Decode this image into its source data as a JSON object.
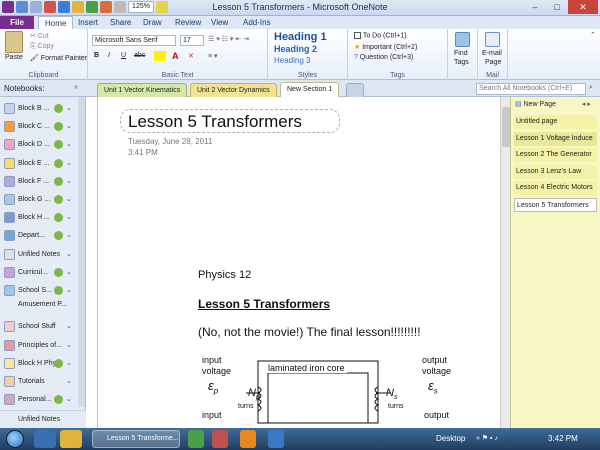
{
  "window": {
    "title": "Lesson 5 Transformers - Microsoft OneNote",
    "min": "–",
    "max": "□",
    "close": "✕"
  },
  "ribbon_tabs": {
    "file": "File",
    "tabs": [
      "Home",
      "Insert",
      "Share",
      "Draw",
      "Review",
      "View",
      "Add-Ins"
    ]
  },
  "qat": {
    "zoom": "125%"
  },
  "clipboard": {
    "paste": "Paste",
    "cut": "Cut",
    "copy": "Copy",
    "format_painter": "Format Painter",
    "label": "Clipboard"
  },
  "basic_text": {
    "font": "Microsoft Sans Serif",
    "size": "17",
    "label": "Basic Text",
    "bold": "B",
    "italic": "I",
    "underline": "U",
    "strike": "abc"
  },
  "styles": {
    "h1": "Heading 1",
    "h2": "Heading 2",
    "h3": "Heading 3",
    "label": "Styles"
  },
  "tags": {
    "todo": "To Do (Ctrl+1)",
    "important": "Important (Ctrl+2)",
    "question": "Question (Ctrl+3)",
    "label": "Tags"
  },
  "find_tags": {
    "label": "Find Tags",
    "l1": "Find",
    "l2": "Tags"
  },
  "email": {
    "l1": "E-mail",
    "l2": "Page",
    "label": "Mail"
  },
  "nav": {
    "notebooks_label": "Notebooks:",
    "sections": [
      "Unit 1 Vector Kinematics",
      "Unit 2 Vector Dynamics",
      "New Section 1"
    ],
    "search_placeholder": "Search All Notebooks (Ctrl+E)"
  },
  "notebooks": [
    {
      "label": "Block B ...",
      "color": "#c4d3ea"
    },
    {
      "label": "Block C ...",
      "color": "#ff9933"
    },
    {
      "label": "Block D ...",
      "color": "#f2a3c6"
    },
    {
      "label": "Block E ...",
      "color": "#ffd966"
    },
    {
      "label": "Block F ...",
      "color": "#b9a6e0"
    },
    {
      "label": "Block G ...",
      "color": "#a8c5e4"
    },
    {
      "label": "Block H ...",
      "color": "#7b9bd1"
    },
    {
      "label": "Depart...",
      "color": "#6fa8dc"
    },
    {
      "label": "Unfiled Notes",
      "color": "#e0e0e0"
    },
    {
      "label": "Curricul...",
      "color": "#c9a0dc"
    },
    {
      "label": "School S...",
      "color": "#9ec6e8"
    },
    {
      "label": "Amusement P...",
      "color": "#a8d08d"
    },
    {
      "label": "School Stuff",
      "color": "#f4cccc"
    },
    {
      "label": "Principles of...",
      "color": "#ea9999"
    },
    {
      "label": "Block H Phy...",
      "color": "#ffe599"
    },
    {
      "label": "Tutorials",
      "color": "#f9cb9c"
    },
    {
      "label": "Personal...",
      "color": "#d5a6bd"
    },
    {
      "label": "Block B",
      "color": "#a4c2f4"
    }
  ],
  "unfiled_bottom": "Unfiled Notes",
  "page": {
    "title": "Lesson 5 Transformers",
    "date": "Tuesday, June 28, 2011",
    "time": "3:41 PM",
    "line1": "Physics 12",
    "line2": "Lesson 5 Transformers",
    "line3": "(No, not the movie!)  The final lesson!!!!!!!!!",
    "input_voltage_1": "input",
    "input_voltage_2": "voltage",
    "eps_p": "ε",
    "eps_p_sub": "p",
    "core_label": "laminated iron core",
    "np": "N",
    "np_sub": "p",
    "np_turns": "turns",
    "ns": "N",
    "ns_sub": "s",
    "ns_turns": "turns",
    "output_voltage_1": "output",
    "output_voltage_2": "voltage",
    "eps_s": "ε",
    "eps_s_sub": "s",
    "input_bottom": "input",
    "output_bottom": "output"
  },
  "pagelist": {
    "new_page": "New Page",
    "items": [
      {
        "label": "Untitled page",
        "bg": "#f3f2a6"
      },
      {
        "label": "Lesson 1 Voltage Induce",
        "bg": "#e8e79a"
      },
      {
        "label": "Lesson 2 The Generator",
        "bg": "#f3f2a6"
      },
      {
        "label": "Lesson 3 Lenz's Law",
        "bg": "#f3f2a6"
      },
      {
        "label": "Lesson 4 Electric Motors",
        "bg": "#f3f2a6"
      },
      {
        "label": "Lesson 5 Transformers",
        "bg": "#ffffff"
      }
    ]
  },
  "taskbar": {
    "active_app": "Lesson 5 Transforme...",
    "desktop": "Desktop",
    "clock": "3:42 PM"
  }
}
